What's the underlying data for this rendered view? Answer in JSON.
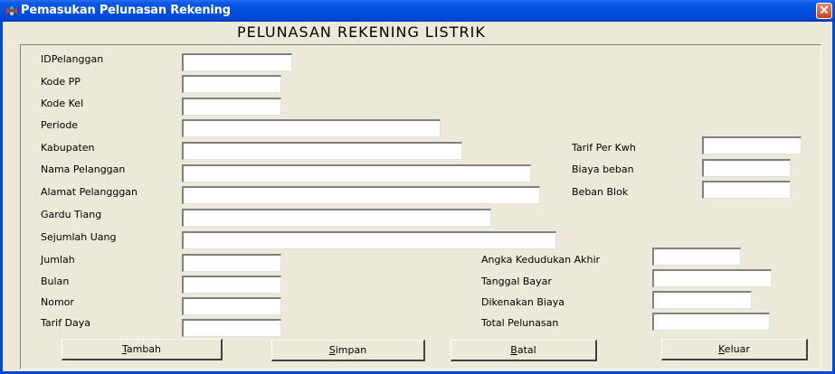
{
  "window": {
    "title": "Pemasukan Pelunasan Rekening",
    "close_glyph": "✕"
  },
  "form": {
    "heading": "PELUNASAN REKENING LISTRIK",
    "labels": {
      "id_pelanggan": "IDPelanggan",
      "kode_pp": "Kode PP",
      "kode_kel": "Kode Kel",
      "periode": "Periode",
      "kabupaten": "Kabupaten",
      "nama_pelanggan": "Nama Pelanggan",
      "alamat_pelanggan": "Alamat Pelangggan",
      "gardu_tiang": "Gardu Tiang",
      "sejumlah_uang": "Sejumlah Uang",
      "jumlah": "Jumlah",
      "bulan": "Bulan",
      "nomor": "Nomor",
      "tarif_daya": "Tarif Daya",
      "tarif_per_kwh": "Tarif Per Kwh",
      "biaya_beban": "Biaya beban",
      "beban_blok": "Beban Blok",
      "angka_kedudukan_akhir": "Angka Kedudukan Akhir",
      "tanggal_bayar": "Tanggal Bayar",
      "dikenakan_biaya": "Dikenakan Biaya",
      "total_pelunasan": "Total Pelunasan"
    }
  },
  "buttons": {
    "tambah": {
      "mnemonic": "T",
      "rest": "ambah"
    },
    "simpan": {
      "mnemonic": "S",
      "rest": "impan"
    },
    "batal": {
      "mnemonic": "B",
      "rest": "atal"
    },
    "keluar": {
      "mnemonic": "K",
      "rest": "eluar"
    }
  },
  "colors": {
    "titlebar": "#0050e0",
    "window_bg": "#ece9d8",
    "close": "#d0401c"
  },
  "icons": {
    "app": "app-icon",
    "close": "close-icon"
  }
}
